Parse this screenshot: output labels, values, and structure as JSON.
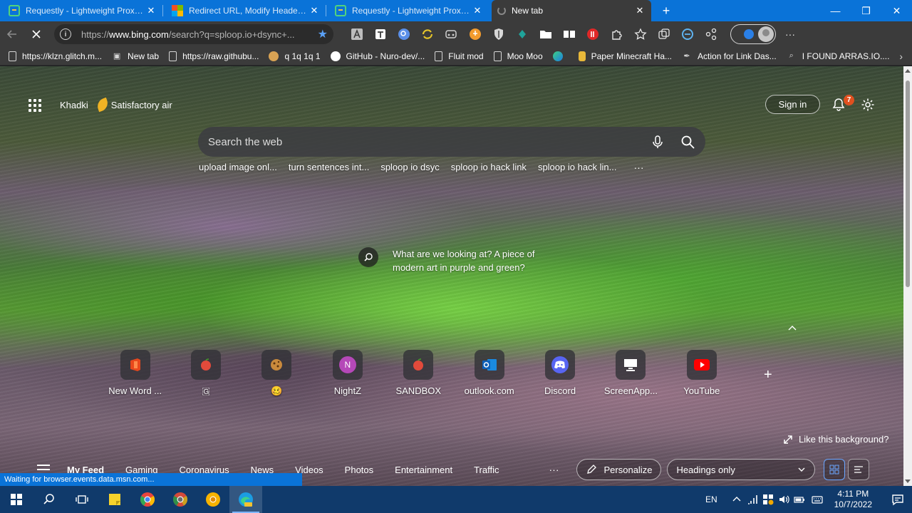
{
  "tabs": [
    {
      "title": "Requestly - Lightweight Proxy to",
      "close": "✕",
      "icon": "requestly-icon"
    },
    {
      "title": "Redirect URL, Modify Headers &",
      "close": "✕",
      "icon": "microsoft-store-icon"
    },
    {
      "title": "Requestly - Lightweight Proxy to",
      "close": "✕",
      "icon": "requestly-icon"
    },
    {
      "title": "New tab",
      "close": "✕",
      "icon": "loading-icon",
      "active": true
    }
  ],
  "new_tab_button": "+",
  "window_controls": {
    "minimize": "—",
    "maximize": "❐",
    "close": "✕"
  },
  "address_bar": {
    "url_prefix": "https://",
    "url_domain": "www.bing.com",
    "url_rest": "/search?q=sploop.io+dsync+..."
  },
  "bookmarks": [
    {
      "label": "https://klzn.glitch.m...",
      "icon": "page-icon"
    },
    {
      "label": "New tab",
      "icon": "newtab-icon"
    },
    {
      "label": "https://raw.githubu...",
      "icon": "page-icon"
    },
    {
      "label": "q 1q 1q 1",
      "icon": "cookie-icon"
    },
    {
      "label": "GitHub - Nuro-dev/...",
      "icon": "github-icon"
    },
    {
      "label": "Fluit mod",
      "icon": "page-icon"
    },
    {
      "label": "Moo Moo",
      "icon": "page-icon"
    },
    {
      "label": "",
      "icon": "edge-icon"
    },
    {
      "label": "Paper Minecraft Ha...",
      "icon": "ladder-icon"
    },
    {
      "label": "Action for Link Das...",
      "icon": "feather-icon"
    },
    {
      "label": "I FOUND ARRAS.IO....",
      "icon": "search-icon"
    }
  ],
  "new_tab_page": {
    "location": "Khadki",
    "weather": "Satisfactory air",
    "sign_in": "Sign in",
    "notification_count": "7",
    "search_placeholder": "Search the web",
    "suggestions": [
      "upload image onl...",
      "turn sentences int...",
      "sploop io dsyc",
      "sploop io hack link",
      "sploop io hack lin..."
    ],
    "suggestions_more": "···",
    "caption": "What are we looking at? A piece of modern art in purple and green?",
    "tiles": [
      {
        "label": "New Word ...",
        "icon": "office-icon"
      },
      {
        "label": "🇬",
        "icon": "apple-icon"
      },
      {
        "label": "🥴",
        "icon": "cookie-icon"
      },
      {
        "label": "NightZ",
        "icon": "letter-n-icon",
        "glyph": "N"
      },
      {
        "label": "SANDBOX",
        "icon": "apple-icon"
      },
      {
        "label": "outlook.com",
        "icon": "outlook-icon"
      },
      {
        "label": "Discord",
        "icon": "discord-icon"
      },
      {
        "label": "ScreenApp...",
        "icon": "screenapp-icon"
      },
      {
        "label": "YouTube",
        "icon": "youtube-icon"
      }
    ],
    "add_tile": "+",
    "like_background": "Like this background?",
    "feed_tabs": [
      "My Feed",
      "Gaming",
      "Coronavirus",
      "News",
      "Videos",
      "Photos",
      "Entertainment",
      "Traffic"
    ],
    "feed_more": "···",
    "personalize": "Personalize",
    "layout_option": "Headings only"
  },
  "status_text": "Waiting for browser.events.data.msn.com...",
  "taskbar": {
    "language": "EN",
    "time": "4:11 PM",
    "date": "10/7/2022"
  },
  "colors": {
    "tabbar": "#0a73d8",
    "toolbar": "#3b3b3b",
    "taskbar": "#103a6b",
    "badge": "#e0501f"
  }
}
